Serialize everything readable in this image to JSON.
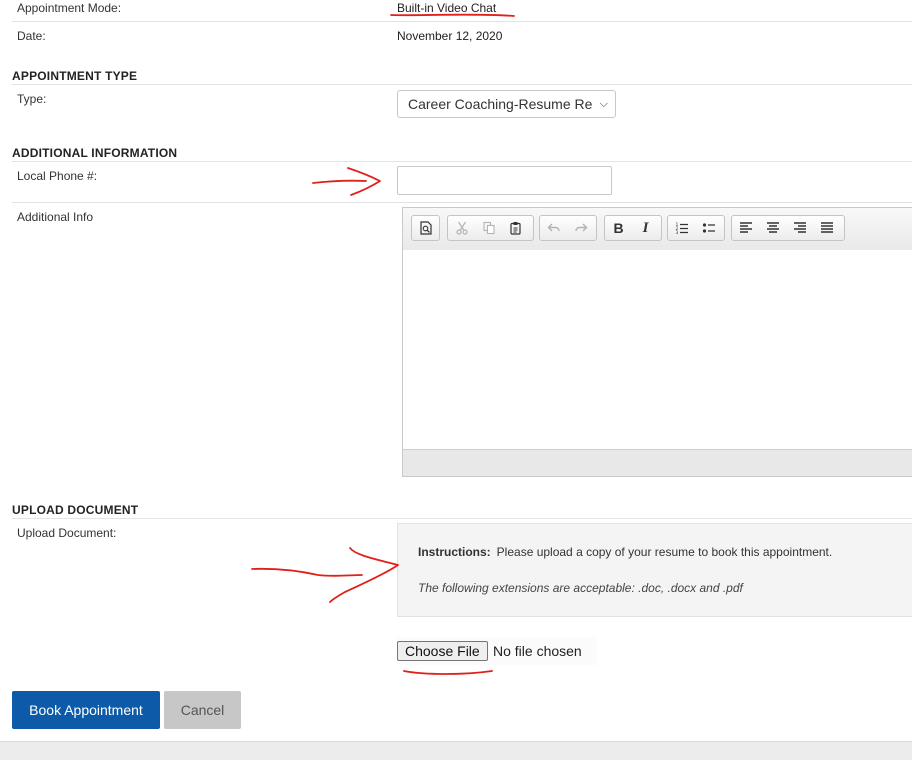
{
  "details": {
    "mode_label": "Appointment Mode:",
    "mode_value": "Built-in Video Chat",
    "date_label": "Date:",
    "date_value": "November 12, 2020"
  },
  "appointment_type": {
    "heading": "APPOINTMENT TYPE",
    "type_label": "Type:",
    "type_selected": "Career Coaching-Resume Re"
  },
  "additional_information": {
    "heading": "ADDITIONAL INFORMATION",
    "phone_label": "Local Phone #:",
    "phone_value": "",
    "info_label": "Additional Info",
    "toolbar_icons": [
      "preview-icon",
      "cut-icon",
      "copy-icon",
      "paste-icon",
      "undo-icon",
      "redo-icon",
      "bold-icon",
      "italic-icon",
      "numbered-list-icon",
      "bullet-list-icon",
      "align-left-icon",
      "align-center-icon",
      "align-right-icon",
      "justify-icon"
    ],
    "bold_glyph": "B",
    "italic_glyph": "I"
  },
  "upload": {
    "heading": "UPLOAD DOCUMENT",
    "label": "Upload Document:",
    "instructions_title": "Instructions:",
    "instructions_text": "Please upload a copy of your resume to book this appointment.",
    "extensions_text": "The following extensions are acceptable: .doc, .docx and .pdf",
    "choose_file_label": "Choose File",
    "no_file_text": "No file chosen"
  },
  "actions": {
    "book_label": "Book Appointment",
    "cancel_label": "Cancel"
  },
  "colors": {
    "primary": "#0d5ba8",
    "annotation_ink": "#e0201b"
  }
}
